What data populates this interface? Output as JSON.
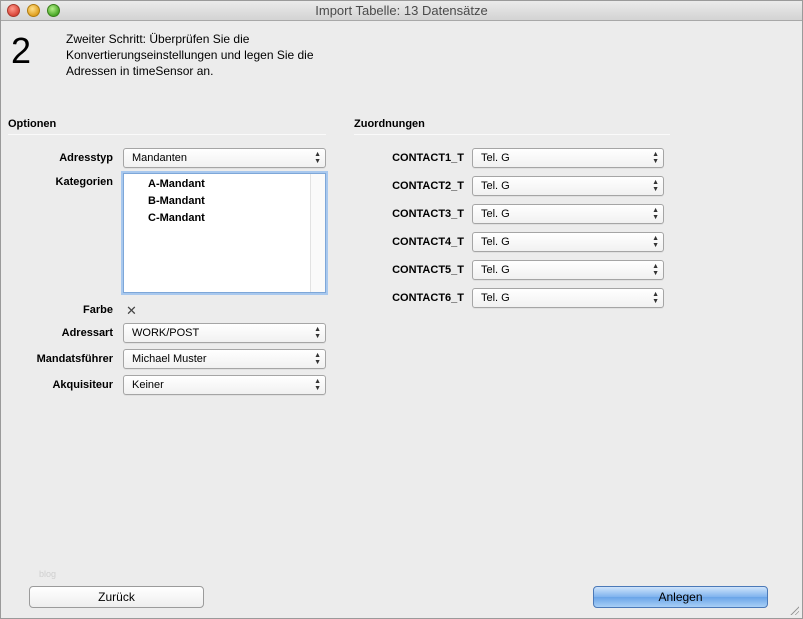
{
  "window": {
    "title": "Import Tabelle: 13 Datensätze"
  },
  "step": {
    "number": "2",
    "text": "Zweiter Schritt: Überprüfen Sie die Konvertierungseinstellungen und legen Sie die Adressen in timeSensor an."
  },
  "options": {
    "title": "Optionen",
    "adresstyp": {
      "label": "Adresstyp",
      "value": "Mandanten"
    },
    "kategorien": {
      "label": "Kategorien",
      "items": [
        "A-Mandant",
        "B-Mandant",
        "C-Mandant"
      ]
    },
    "farbe": {
      "label": "Farbe",
      "value": "✕"
    },
    "adressart": {
      "label": "Adressart",
      "value": "WORK/POST"
    },
    "mandatsfuehrer": {
      "label": "Mandatsführer",
      "value": "Michael Muster"
    },
    "akquisiteur": {
      "label": "Akquisiteur",
      "value": "Keiner"
    }
  },
  "mappings": {
    "title": "Zuordnungen",
    "rows": [
      {
        "label": "CONTACT1_T",
        "value": "Tel. G"
      },
      {
        "label": "CONTACT2_T",
        "value": "Tel. G"
      },
      {
        "label": "CONTACT3_T",
        "value": "Tel. G"
      },
      {
        "label": "CONTACT4_T",
        "value": "Tel. G"
      },
      {
        "label": "CONTACT5_T",
        "value": "Tel. G"
      },
      {
        "label": "CONTACT6_T",
        "value": "Tel. G"
      }
    ]
  },
  "buttons": {
    "back": "Zurück",
    "create": "Anlegen"
  },
  "watermark": "blog",
  "colors": {
    "default_button": "#6aa4e8",
    "focus_ring": "#a8c8ee"
  },
  "icons": {
    "close": "close-icon",
    "minimize": "minimize-icon",
    "zoom": "zoom-icon",
    "popup": "updown-arrows-icon"
  }
}
